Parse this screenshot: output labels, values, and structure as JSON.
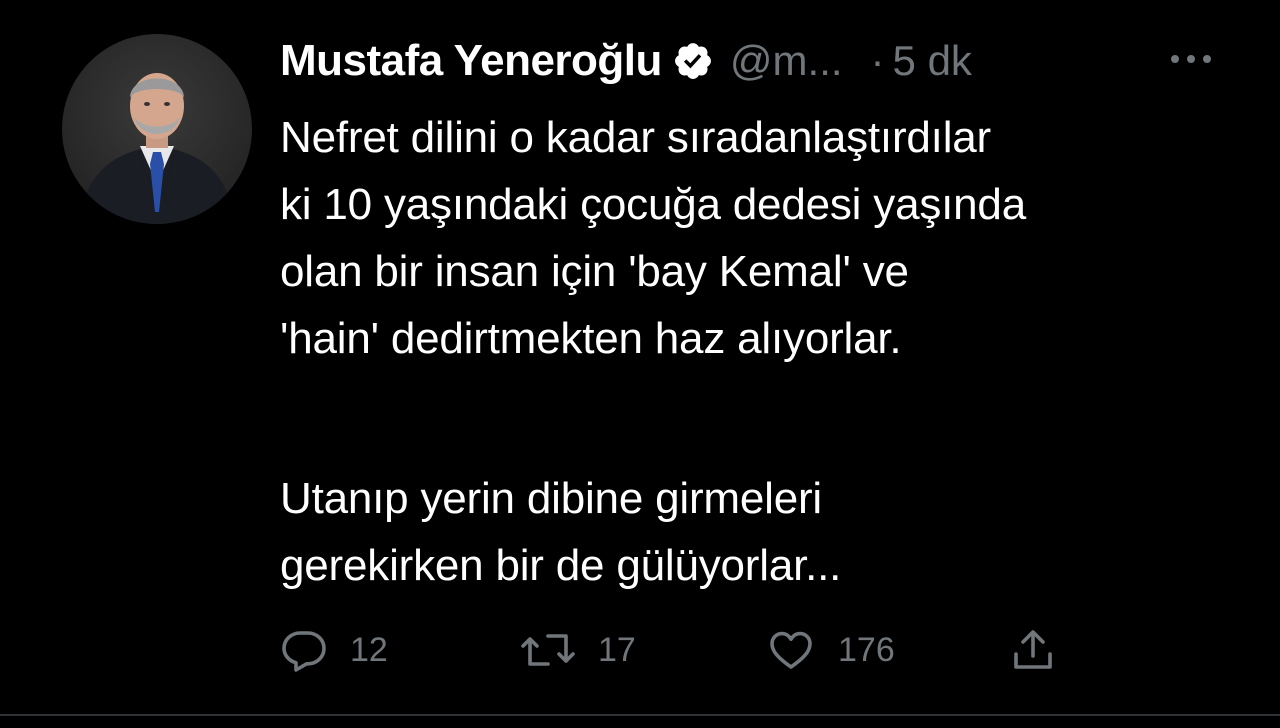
{
  "tweet": {
    "author": {
      "display_name": "Mustafa Yeneroğlu",
      "handle": "@m...",
      "verified": true,
      "avatar_icon": "profile-photo-man-in-suit"
    },
    "separator": "·",
    "time": "5 dk",
    "more_icon": "more-horizontal-icon",
    "text_paragraph_1": "Nefret dilini o kadar sıradanlaştırdılar\nki 10 yaşındaki çocuğa dedesi yaşında\nolan bir insan için 'bay Kemal' ve\n'hain' dedirtmekten haz alıyorlar.",
    "text_paragraph_2": "Utanıp yerin dibine girmeleri\ngerekirken bir de gülüyorlar...",
    "actions": {
      "reply": {
        "icon": "reply-icon",
        "count": "12"
      },
      "retweet": {
        "icon": "retweet-icon",
        "count": "17"
      },
      "like": {
        "icon": "heart-icon",
        "count": "176"
      },
      "share": {
        "icon": "share-icon"
      }
    }
  },
  "colors": {
    "background": "#000000",
    "text": "#ffffff",
    "secondary": "#71767b",
    "divider": "#2f3336"
  }
}
